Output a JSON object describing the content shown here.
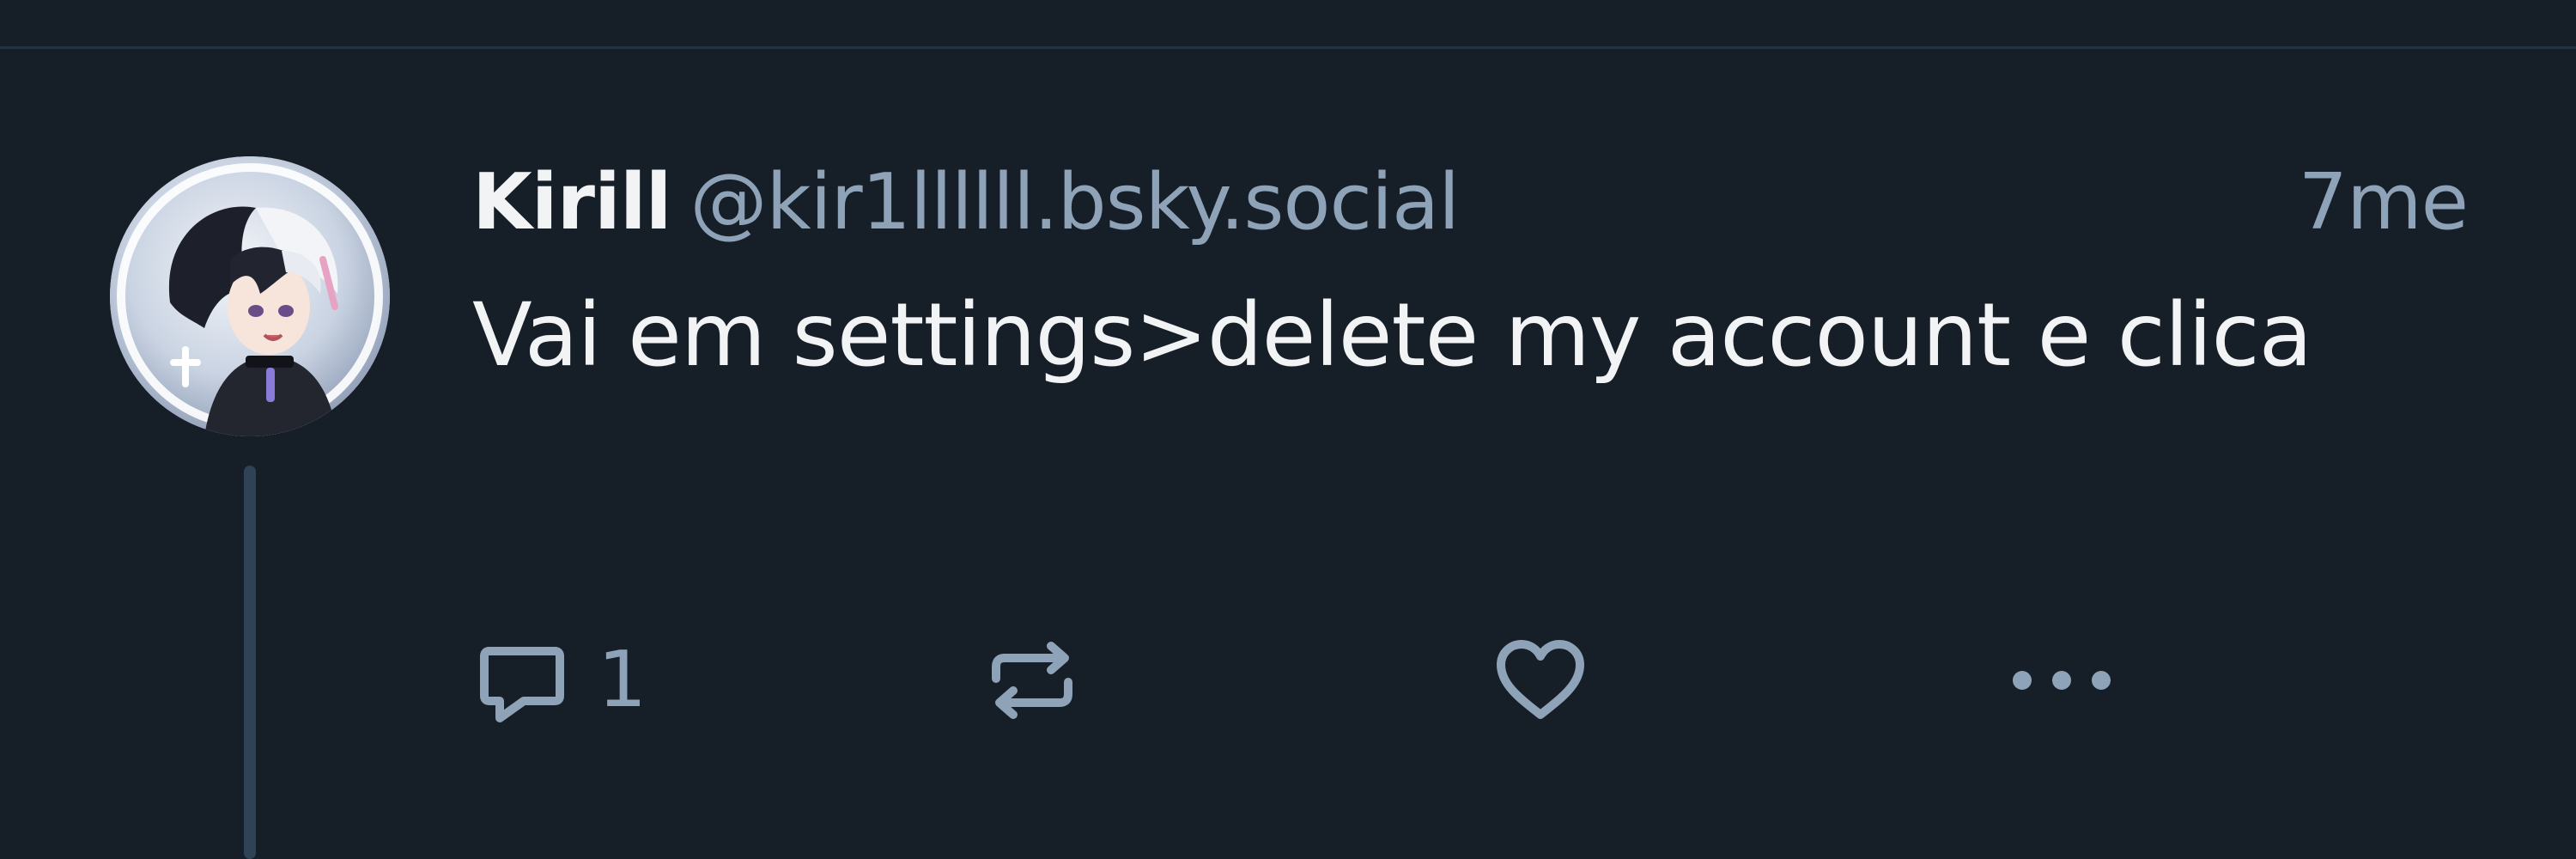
{
  "post": {
    "author": {
      "display_name": "Kirill",
      "handle": "@kir1llllll.bsky.social",
      "avatar_icon": "avatar-image"
    },
    "timestamp": "7me",
    "text": "Vai em settings>delete my account e clica"
  },
  "actions": {
    "reply": {
      "icon": "reply-icon",
      "count": "1"
    },
    "repost": {
      "icon": "repost-icon"
    },
    "like": {
      "icon": "heart-icon"
    },
    "more": {
      "icon": "more-options-icon"
    }
  },
  "colors": {
    "background": "#161e27",
    "primary_text": "#f1f3f5",
    "secondary_text": "#8fa3b8",
    "thread_line": "#2f4256",
    "divider": "#253241"
  }
}
